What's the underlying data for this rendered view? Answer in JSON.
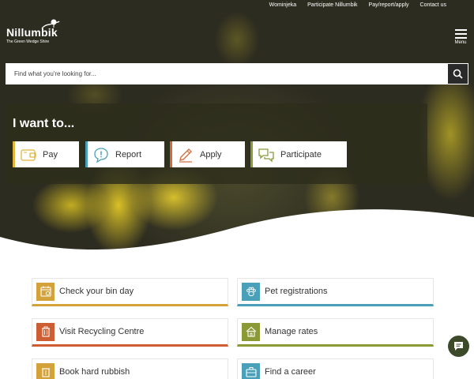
{
  "utility_links": [
    "Wominjeka",
    "Participate Nillumbik",
    "Pay/report/apply",
    "Contact us"
  ],
  "logo": {
    "name": "Nillumbik",
    "tagline": "The Green Wedge Shire"
  },
  "menu": {
    "label": "Menu"
  },
  "search": {
    "placeholder": "Find what you're looking for..."
  },
  "i_want_to": {
    "title": "I want to...",
    "buttons": [
      {
        "label": "Pay",
        "icon": "wallet-icon",
        "color": "#e0b53a"
      },
      {
        "label": "Report",
        "icon": "alert-bubble-icon",
        "color": "#48a1b9"
      },
      {
        "label": "Apply",
        "icon": "pencil-icon",
        "color": "#d2693a"
      },
      {
        "label": "Participate",
        "icon": "chat-bubbles-icon",
        "color": "#8a9a3a"
      }
    ]
  },
  "quick_links": [
    {
      "label": "Check your bin day",
      "icon": "calendar-icon",
      "color": "#d4a23a"
    },
    {
      "label": "Pet registrations",
      "icon": "paw-icon",
      "color": "#4aa0b8"
    },
    {
      "label": "Visit Recycling Centre",
      "icon": "bin-icon",
      "color": "#cd5e33"
    },
    {
      "label": "Manage rates",
      "icon": "house-icon",
      "color": "#8b9a37"
    },
    {
      "label": "Book hard rubbish",
      "icon": "trash-icon",
      "color": "#d4a23a"
    },
    {
      "label": "Find a career",
      "icon": "briefcase-icon",
      "color": "#4aa0b8"
    }
  ],
  "colors": {
    "dark_button": "#2a2a2a",
    "chat_button": "#3c4a2a"
  }
}
